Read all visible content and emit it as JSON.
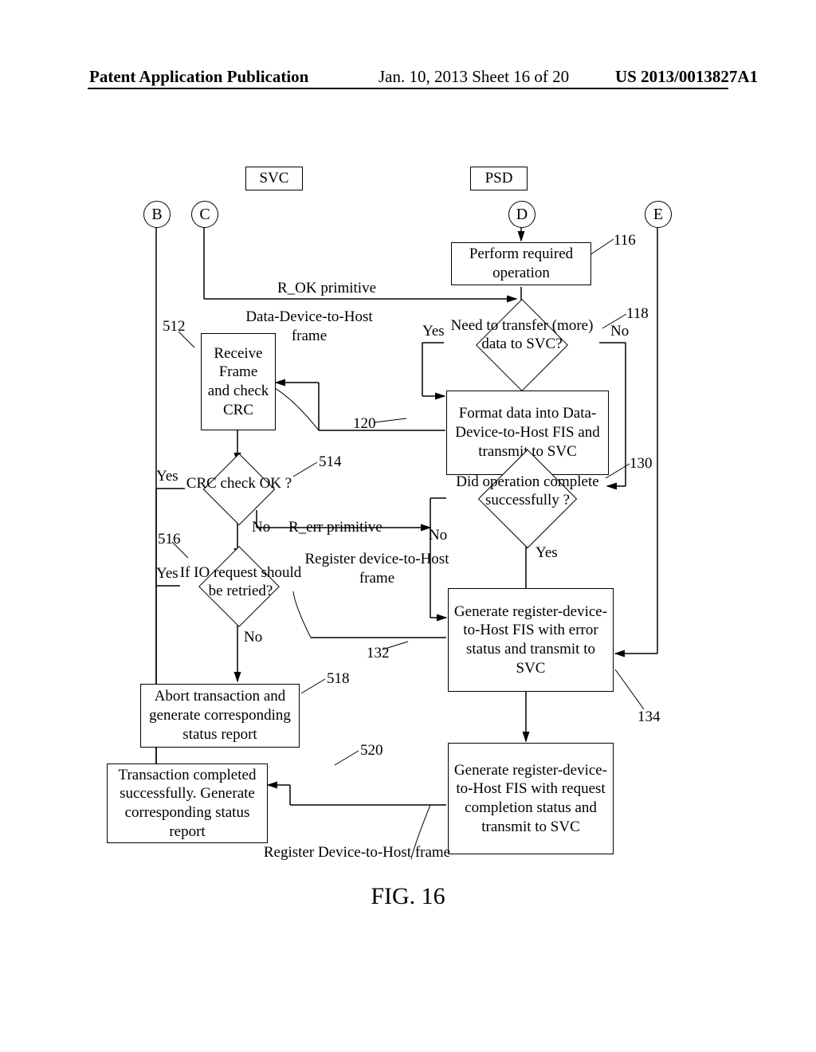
{
  "header": {
    "left": "Patent Application Publication",
    "mid": "Jan. 10, 2013  Sheet 16 of 20",
    "right": "US 2013/0013827A1"
  },
  "top": {
    "svc": "SVC",
    "psd": "PSD"
  },
  "conn": {
    "B": "B",
    "C": "C",
    "D": "D",
    "E": "E"
  },
  "ref": {
    "r116": "116",
    "r118": "118",
    "r120": "120",
    "r130": "130",
    "r132": "132",
    "r134": "134",
    "r512": "512",
    "r514": "514",
    "r516": "516",
    "r518": "518",
    "r520": "520"
  },
  "txt": {
    "rok": "R_OK primitive",
    "ddh": "Data-Device-to-Host frame",
    "rerr": "R_err primitive",
    "rdh1": "Register device-to-Host frame",
    "rdh2": "Register Device-to-Host frame",
    "yes": "Yes",
    "no": "No"
  },
  "box": {
    "b116": "Perform required operation",
    "b512": "Receive Frame and check CRC",
    "b120": "Format data into Data-Device-to-Host FIS and transmit to SVC",
    "b132": "Generate register-device-to-Host FIS with error status and transmit to SVC",
    "b134": "Generate register-device-to-Host FIS with  request completion  status and transmit to SVC",
    "b518": "Abort transaction and generate corresponding status report",
    "b520": "Transaction completed successfully. Generate corresponding status report"
  },
  "dia": {
    "d118": "Need to transfer (more) data to SVC?",
    "d514": "CRC check OK ?",
    "d130": "Did operation complete successfully ?",
    "d516": "If IO request should be retried?"
  },
  "figure": "FIG. 16"
}
